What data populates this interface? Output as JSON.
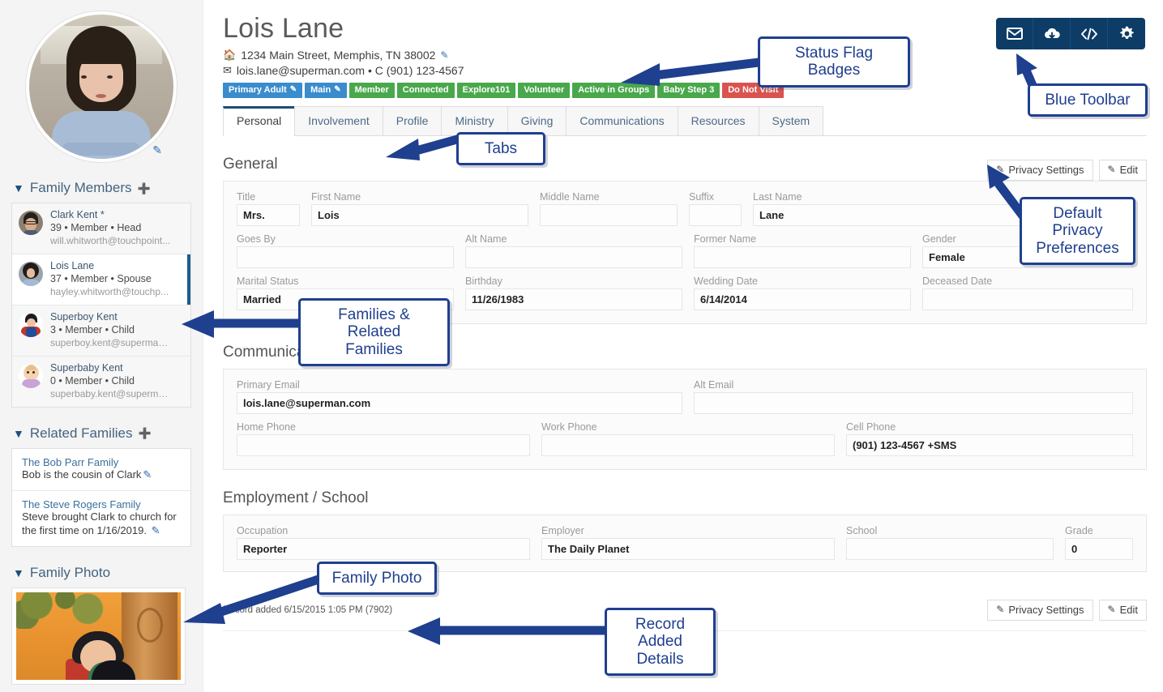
{
  "colors": {
    "badge_blue": "#3a8ccc",
    "badge_green": "#49a84c",
    "badge_red": "#d9534f",
    "toolbar_blue": "#0d3c66",
    "annotation_blue": "#1f3f8f",
    "tab_active_border": "#1b4f72"
  },
  "person": {
    "name": "Lois Lane",
    "address": "1234 Main Street, Memphis, TN 38002",
    "email_phone": "lois.lane@superman.com • C (901) 123-4567",
    "home_icon": "home-icon",
    "envelope_icon": "envelope-icon",
    "edit_pencil": "✎"
  },
  "badges": [
    {
      "label": "Primary Adult",
      "color": "blue",
      "has_pencil": true
    },
    {
      "label": "Main",
      "color": "blue",
      "has_pencil": true
    },
    {
      "label": "Member",
      "color": "green",
      "has_pencil": false
    },
    {
      "label": "Connected",
      "color": "green",
      "has_pencil": false
    },
    {
      "label": "Explore101",
      "color": "green",
      "has_pencil": false
    },
    {
      "label": "Volunteer",
      "color": "green",
      "has_pencil": false
    },
    {
      "label": "Active in Groups",
      "color": "green",
      "has_pencil": false
    },
    {
      "label": "Baby Step 3",
      "color": "green",
      "has_pencil": false
    },
    {
      "label": "Do Not Visit",
      "color": "red",
      "has_pencil": false
    }
  ],
  "tabs": [
    {
      "label": "Personal",
      "active": true
    },
    {
      "label": "Involvement",
      "active": false
    },
    {
      "label": "Profile",
      "active": false
    },
    {
      "label": "Ministry",
      "active": false
    },
    {
      "label": "Giving",
      "active": false
    },
    {
      "label": "Communications",
      "active": false
    },
    {
      "label": "Resources",
      "active": false
    },
    {
      "label": "System",
      "active": false
    }
  ],
  "toolbar": {
    "buttons": [
      {
        "icon": "envelope-icon"
      },
      {
        "icon": "cloud-download-icon"
      },
      {
        "icon": "code-icon"
      },
      {
        "icon": "gear-icon"
      }
    ]
  },
  "sidebar": {
    "family_members": {
      "title": "Family Members",
      "caret_icon": "chevron-circle-down-icon",
      "add_icon": "plus-circle-icon",
      "members": [
        {
          "name": "Clark Kent *",
          "meta": "39 • Member • Head",
          "email": "will.whitworth@touchpoint...",
          "active": false
        },
        {
          "name": "Lois Lane",
          "meta": "37 • Member • Spouse",
          "email": "hayley.whitworth@touchp...",
          "active": true
        },
        {
          "name": "Superboy Kent",
          "meta": "3 • Member • Child",
          "email": "superboy.kent@superman....",
          "active": false
        },
        {
          "name": "Superbaby Kent",
          "meta": "0 • Member • Child",
          "email": "superbaby.kent@superma...",
          "active": false
        }
      ]
    },
    "related_families": {
      "title": "Related Families",
      "caret_icon": "chevron-circle-down-icon",
      "add_icon": "plus-circle-icon",
      "items": [
        {
          "title": "The Bob Parr Family",
          "desc": "Bob is the cousin of Clark"
        },
        {
          "title": "The Steve Rogers Family",
          "desc": "Steve brought Clark to church for the first time on 1/16/2019."
        }
      ]
    },
    "family_photo": {
      "title": "Family Photo",
      "caret_icon": "chevron-circle-down-icon"
    }
  },
  "main": {
    "general": {
      "title": "General",
      "privacy_button": "Privacy Settings",
      "edit_button": "Edit",
      "fields": [
        {
          "label": "Title",
          "value": "Mrs."
        },
        {
          "label": "First Name",
          "value": "Lois"
        },
        {
          "label": "Middle Name",
          "value": ""
        },
        {
          "label": "Suffix",
          "value": ""
        },
        {
          "label": "Last Name",
          "value": "Lane"
        },
        {
          "label": "Goes By",
          "value": ""
        },
        {
          "label": "Alt Name",
          "value": ""
        },
        {
          "label": "Former Name",
          "value": ""
        },
        {
          "label": "Gender",
          "value": "Female"
        },
        {
          "label": "Marital Status",
          "value": "Married"
        },
        {
          "label": "Birthday",
          "value": "11/26/1983"
        },
        {
          "label": "Wedding Date",
          "value": "6/14/2014"
        },
        {
          "label": "Deceased Date",
          "value": ""
        }
      ]
    },
    "communication": {
      "title": "Communication",
      "fields": [
        {
          "label": "Primary Email",
          "value": "lois.lane@superman.com"
        },
        {
          "label": "Alt Email",
          "value": ""
        },
        {
          "label": "Home Phone",
          "value": ""
        },
        {
          "label": "Work Phone",
          "value": ""
        },
        {
          "label": "Cell Phone",
          "value": "(901) 123-4567 +SMS"
        }
      ]
    },
    "employment": {
      "title": "Employment / School",
      "fields": [
        {
          "label": "Occupation",
          "value": "Reporter"
        },
        {
          "label": "Employer",
          "value": "The Daily Planet"
        },
        {
          "label": "School",
          "value": ""
        },
        {
          "label": "Grade",
          "value": "0"
        }
      ]
    },
    "footer": {
      "record_added": "Record added 6/15/2015 1:05 PM (7902)",
      "privacy_button": "Privacy Settings",
      "edit_button": "Edit"
    }
  },
  "annotations": [
    {
      "id": "status-flag-badges",
      "text": "Status Flag Badges"
    },
    {
      "id": "blue-toolbar",
      "text": "Blue Toolbar"
    },
    {
      "id": "tabs",
      "text": "Tabs"
    },
    {
      "id": "default-privacy",
      "text": "Default Privacy\nPreferences"
    },
    {
      "id": "families-related",
      "text": "Families & Related\nFamilies"
    },
    {
      "id": "family-photo",
      "text": "Family Photo"
    },
    {
      "id": "record-added-details",
      "text": "Record Added\nDetails"
    }
  ]
}
